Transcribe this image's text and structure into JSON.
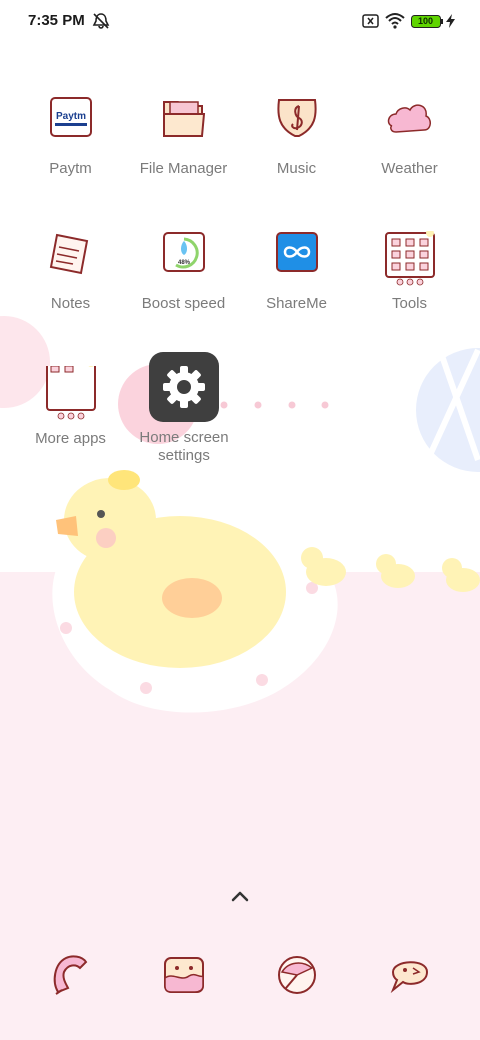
{
  "status_bar": {
    "time": "7:35 PM",
    "battery_level": "100",
    "icons": [
      "alarm-off-icon",
      "sim-error-icon",
      "wifi-icon",
      "battery-icon",
      "charging-bolt-icon"
    ]
  },
  "apps": [
    {
      "label": "Paytm",
      "icon": "paytm-logo-icon",
      "logo_text": "Paytm"
    },
    {
      "label": "File Manager",
      "icon": "folder-icon"
    },
    {
      "label": "Music",
      "icon": "music-note-icon"
    },
    {
      "label": "Weather",
      "icon": "cloud-icon"
    },
    {
      "label": "Notes",
      "icon": "notepad-icon"
    },
    {
      "label": "Boost speed",
      "icon": "rocket-gauge-icon",
      "gauge_text": "48%"
    },
    {
      "label": "ShareMe",
      "icon": "infinity-icon"
    },
    {
      "label": "Tools",
      "icon": "tools-folder-icon"
    },
    {
      "label": "More apps",
      "icon": "more-apps-folder-icon"
    }
  ],
  "popup": {
    "label": "Home screen settings",
    "icon": "gear-icon"
  },
  "dock": {
    "icons": [
      "phone-icon",
      "messages-icon",
      "browser-icon",
      "chat-icon"
    ]
  },
  "colors": {
    "label_gray": "#7b7b7b",
    "wallpaper_pink": "#fdeef3",
    "duck_yellow": "#fff3b6",
    "popup_dark": "#3f3f3f",
    "icon_outline": "#8c2a2a",
    "battery_green": "#5fd400"
  }
}
